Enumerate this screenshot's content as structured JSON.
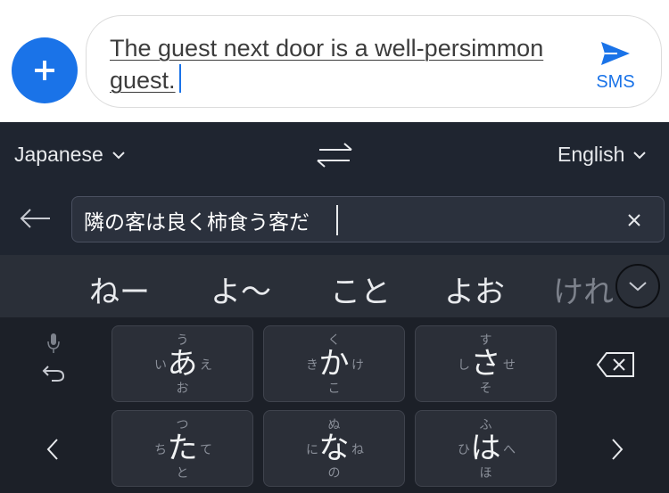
{
  "compose": {
    "message_text": "The guest next door is a well-persimmon guest.",
    "send_label": "SMS",
    "colors": {
      "accent": "#1a73e8"
    }
  },
  "translate": {
    "source_language": "Japanese",
    "target_language": "English",
    "source_text": "隣の客は良く柿食う客だ",
    "clear_icon": "close-icon",
    "swap_icon": "swap-icon"
  },
  "suggestions": [
    "ねー",
    "よ〜",
    "こと",
    "よお",
    "けれ"
  ],
  "keypad": {
    "keys": [
      {
        "main": "あ",
        "top": "う",
        "left": "い",
        "right": "え",
        "bottom": "お"
      },
      {
        "main": "か",
        "top": "く",
        "left": "き",
        "right": "け",
        "bottom": "こ"
      },
      {
        "main": "さ",
        "top": "す",
        "left": "し",
        "right": "せ",
        "bottom": "そ"
      },
      {
        "main": "た",
        "top": "つ",
        "left": "ち",
        "right": "て",
        "bottom": "と"
      },
      {
        "main": "な",
        "top": "ぬ",
        "left": "に",
        "right": "ね",
        "bottom": "の"
      },
      {
        "main": "は",
        "top": "ふ",
        "left": "ひ",
        "right": "へ",
        "bottom": "ほ"
      }
    ]
  }
}
